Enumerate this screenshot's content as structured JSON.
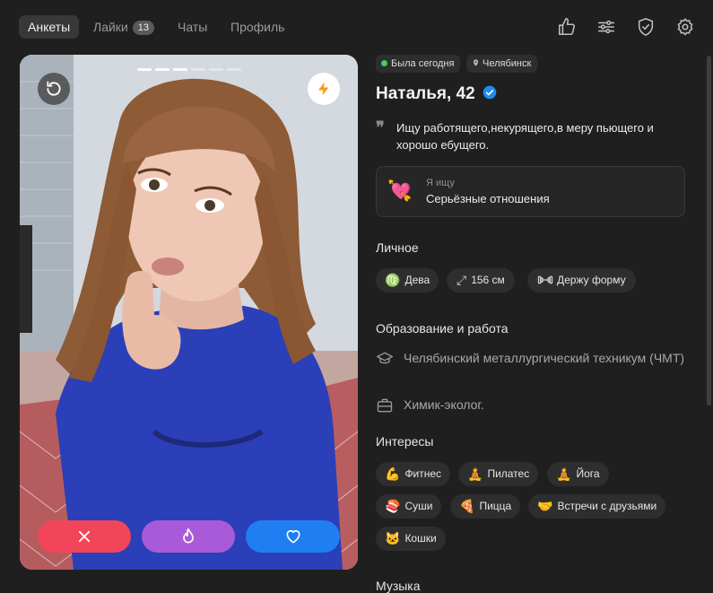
{
  "nav": {
    "tabs": [
      {
        "label": "Анкеты",
        "active": true
      },
      {
        "label": "Лайки",
        "badge": "13"
      },
      {
        "label": "Чаты"
      },
      {
        "label": "Профиль"
      }
    ],
    "icons": [
      "thumbs-up-icon",
      "sliders-icon",
      "shield-check-icon",
      "gear-icon"
    ]
  },
  "photo": {
    "pages_total": 6,
    "current_page": 3
  },
  "actions": {
    "dislike_color": "#f2455a",
    "superlike_color": "#a95ad8",
    "like_color": "#1f7ff2"
  },
  "profile": {
    "status": "Была сегодня",
    "status_color": "#3ecf5c",
    "city": "Челябинск",
    "name_age": "Наталья, 42",
    "verified_color": "#1f8bf2",
    "about": "Ищу работящего,некурящего,в меру пьющего и хорошо ебущего.",
    "looking_label": "Я ищу",
    "looking_value": "Серьёзные отношения",
    "looking_emoji": "💘",
    "personal_title": "Личное",
    "personal": [
      {
        "icon": "♍",
        "label": "Дева"
      },
      {
        "icon": "⤢",
        "label": "156 см"
      },
      {
        "icon": "🏋",
        "label": "Держу форму"
      }
    ],
    "edu_title": "Образование и работа",
    "education": "Челябинский металлургический техникум (ЧМТ)",
    "job": "Химик-эколог.",
    "interests_title": "Интересы",
    "interests": [
      {
        "emoji": "💪",
        "label": "Фитнес"
      },
      {
        "emoji": "🧘",
        "label": "Пилатес"
      },
      {
        "emoji": "🧘",
        "label": "Йога"
      },
      {
        "emoji": "🍣",
        "label": "Суши"
      },
      {
        "emoji": "🍕",
        "label": "Пицца"
      },
      {
        "emoji": "🤝",
        "label": "Встречи с друзьями"
      },
      {
        "emoji": "🐱",
        "label": "Кошки"
      }
    ],
    "music_title": "Музыка"
  }
}
